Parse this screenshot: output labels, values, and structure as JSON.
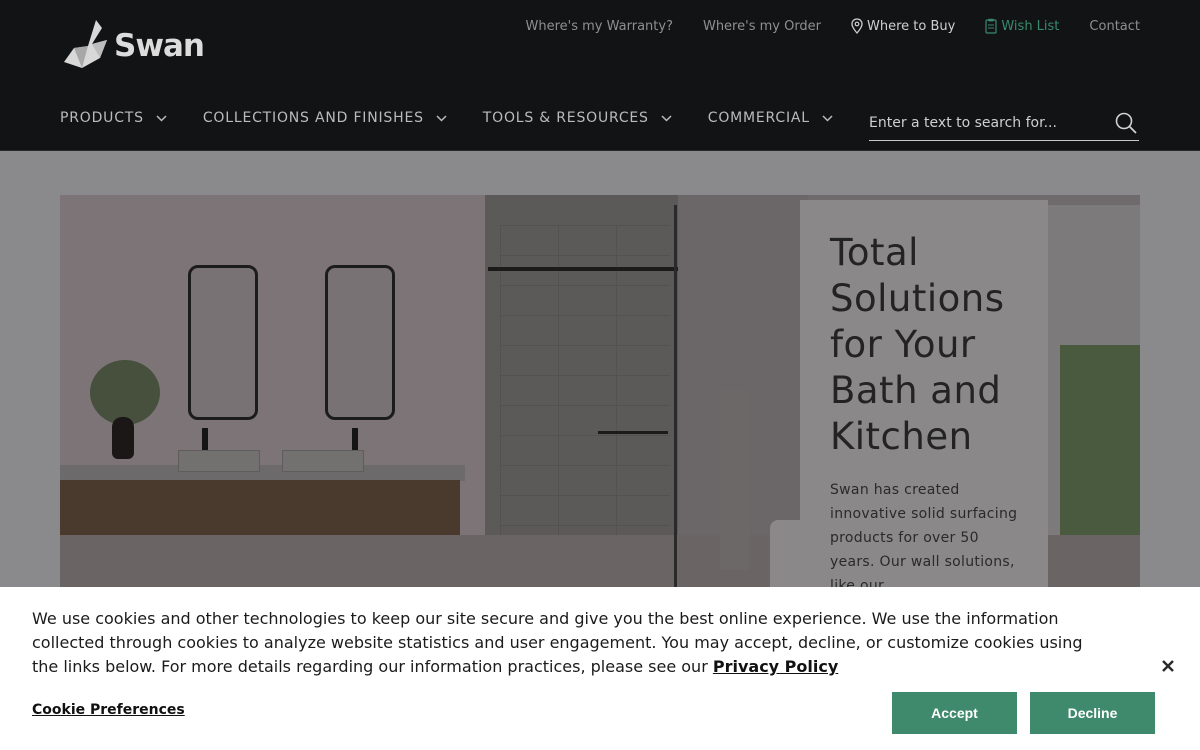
{
  "header": {
    "logo_text": "Swan",
    "utility_links": [
      {
        "label": "Where's my Warranty?"
      },
      {
        "label": "Where's my Order"
      },
      {
        "label": "Where to Buy"
      },
      {
        "label": "Wish List"
      },
      {
        "label": "Contact"
      }
    ],
    "nav": [
      {
        "label": "PRODUCTS"
      },
      {
        "label": "COLLECTIONS AND FINISHES"
      },
      {
        "label": "TOOLS & RESOURCES"
      },
      {
        "label": "COMMERCIAL"
      }
    ],
    "search": {
      "placeholder": "Enter a text to search for..."
    }
  },
  "hero": {
    "title": "Total Solutions for Your Bath and Kitchen",
    "body": "Swan has created innovative solid surfacing products for over 50 years. Our wall solutions, like our"
  },
  "cookie_banner": {
    "text": "We use cookies and other technologies to keep our site secure and give you the best online experience. We use the information collected through cookies to analyze website statistics and user engagement. You may accept, decline, or customize cookies using the links below. For more details regarding our information practices, please see our ",
    "privacy_link": "Privacy Policy",
    "preferences_link": "Cookie Preferences",
    "accept_label": "Accept",
    "decline_label": "Decline"
  },
  "colors": {
    "header_bg": "#121315",
    "accent_green": "#3f8a6c"
  },
  "icons": {
    "logo": "swan-logo-icon",
    "where_to_buy": "map-pin-icon",
    "wish_list": "clipboard-icon",
    "nav_chevron": "chevron-down-icon",
    "search": "search-icon",
    "close": "close-icon"
  }
}
